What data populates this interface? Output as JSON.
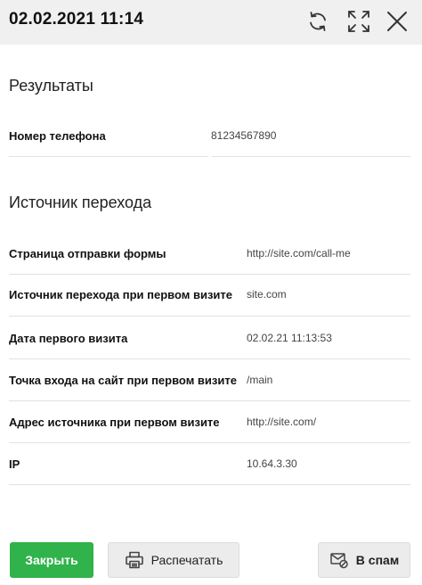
{
  "header": {
    "title": "02.02.2021 11:14",
    "icons": [
      "refresh-icon",
      "expand-icon",
      "close-icon"
    ]
  },
  "results": {
    "title": "Результаты",
    "phone_label": "Номер телефона",
    "phone_value": "81234567890"
  },
  "source": {
    "title": "Источник перехода",
    "rows": [
      {
        "label": "Страница отправки формы",
        "value": "http://site.com/call-me"
      },
      {
        "label": "Источник перехода при первом визите",
        "value": "site.com"
      },
      {
        "label": "Дата первого визита",
        "value": "02.02.21 11:13:53"
      },
      {
        "label": "Точка входа на сайт при первом визите",
        "value": "/main"
      },
      {
        "label": "Адрес источника при первом визите",
        "value": "http://site.com/"
      },
      {
        "label": "IP",
        "value": "10.64.3.30"
      }
    ]
  },
  "footer": {
    "close_label": "Закрыть",
    "print_label": "Распечатать",
    "spam_label": "В спам"
  },
  "colors": {
    "primary": "#2fb34a",
    "header_bg": "#f0f0f0",
    "button_bg": "#ececec"
  }
}
